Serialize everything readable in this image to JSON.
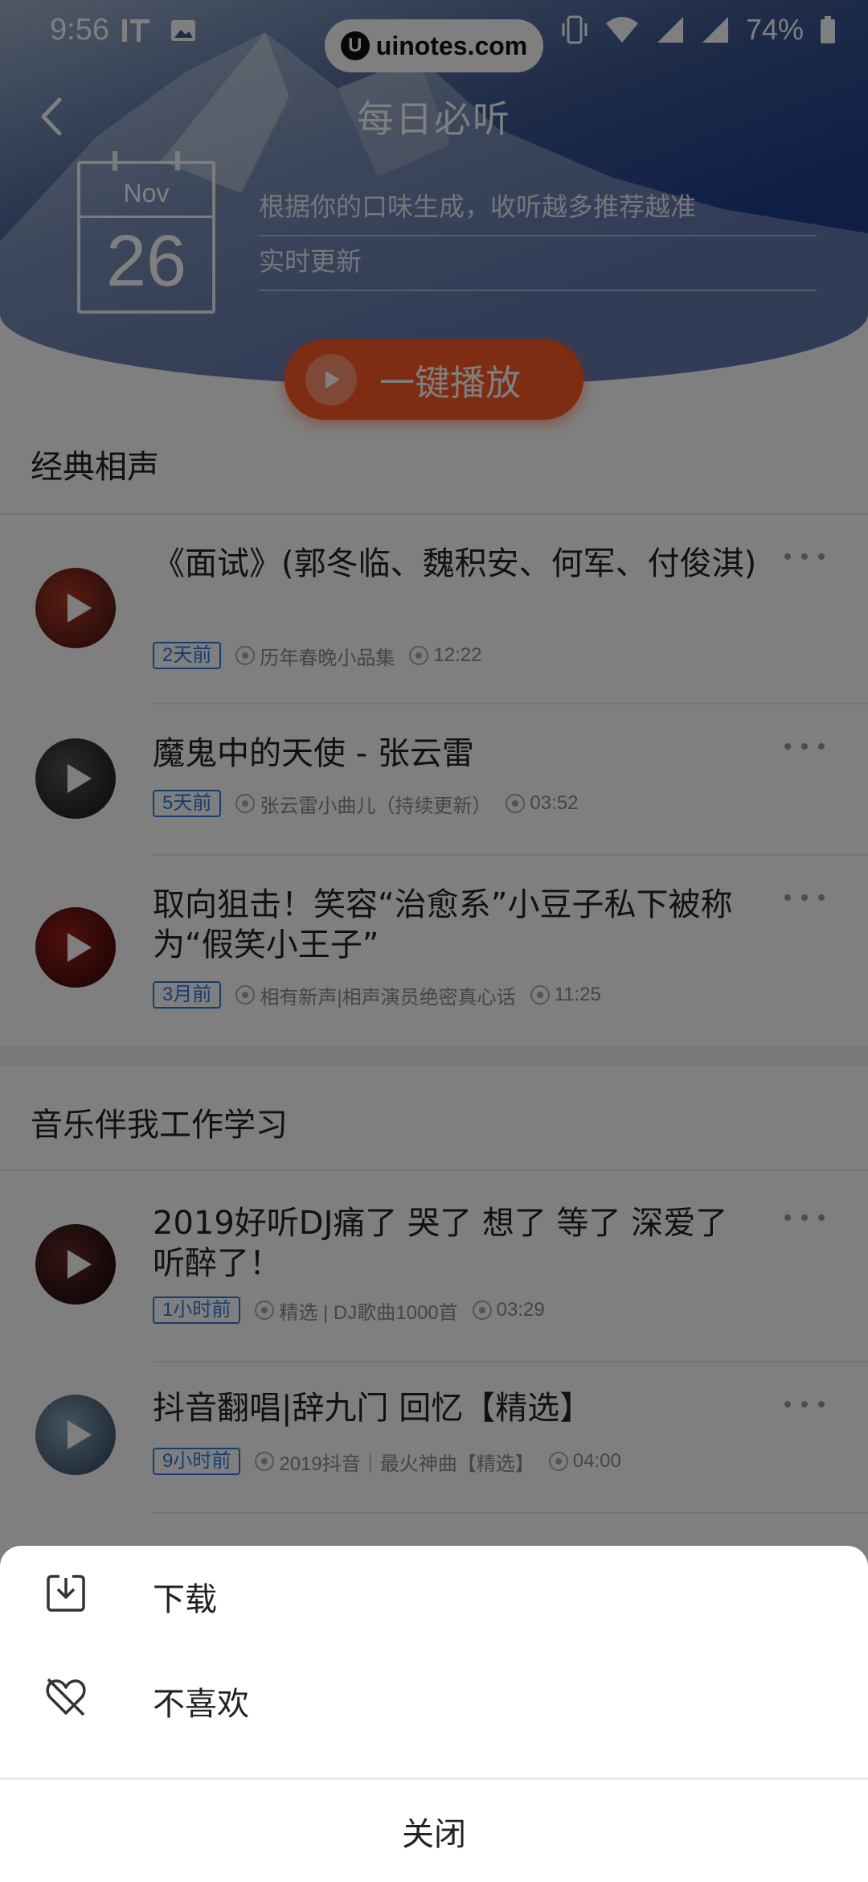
{
  "status_bar": {
    "time": "9:56",
    "battery": "74%"
  },
  "watermark": {
    "logo": "U",
    "text": "uinotes.com"
  },
  "header": {
    "title": "每日必听",
    "calendar_month": "Nov",
    "calendar_day": "26",
    "desc_line1": "根据你的口味生成，收听越多推荐越准",
    "desc_line2": "实时更新",
    "play_all_label": "一键播放"
  },
  "sections": [
    {
      "title": "经典相声",
      "tracks": [
        {
          "title": "《面试》(郭冬临、魏积安、何军、付俊淇)",
          "badge": "2天前",
          "album": "历年春晚小品集",
          "duration": "12:22"
        },
        {
          "title": "魔鬼中的天使 - 张云雷",
          "badge": "5天前",
          "album": "张云雷小曲儿（持续更新）",
          "duration": "03:52"
        },
        {
          "title": "取向狙击！笑容“治愈系”小豆子私下被称为“假笑小王子”",
          "badge": "3月前",
          "album": "相有新声|相声演员绝密真心话",
          "duration": "11:25"
        }
      ]
    },
    {
      "title": "音乐伴我工作学习",
      "tracks": [
        {
          "title": "2019好听DJ痛了 哭了 想了 等了 深爱了 听醉了！",
          "badge": "1小时前",
          "album": "精选 | DJ歌曲1000首",
          "duration": "03:29"
        },
        {
          "title": "抖音翻唱|辞九门 回忆【精选】",
          "badge": "9小时前",
          "album": "2019抖音｜最火神曲【精选】",
          "duration": "04:00"
        }
      ]
    }
  ],
  "sheet": {
    "download_label": "下载",
    "dislike_label": "不喜欢",
    "close_label": "关闭"
  },
  "colors": {
    "accent": "#ff5a24",
    "badge_blue": "#2d7ae0",
    "header_blue": "#1f3d8a"
  }
}
